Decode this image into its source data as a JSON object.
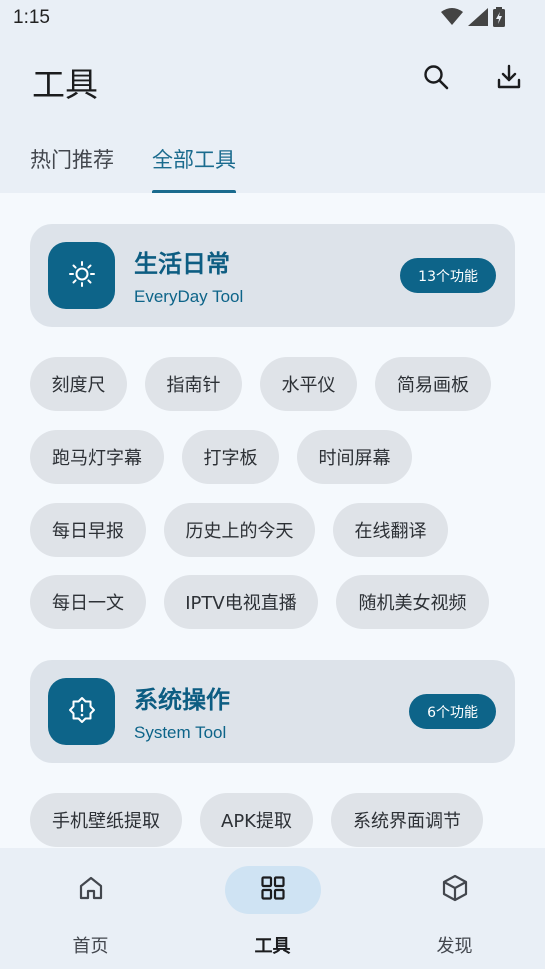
{
  "status_bar": {
    "time": "1:15"
  },
  "app_bar": {
    "title": "工具",
    "search_icon": "search-icon",
    "download_icon": "download-icon"
  },
  "tabs": [
    {
      "label": "热门推荐",
      "active": false
    },
    {
      "label": "全部工具",
      "active": true
    }
  ],
  "categories": [
    {
      "title": "生活日常",
      "subtitle": "EveryDay Tool",
      "badge": "13个功能",
      "icon": "sun-icon",
      "tools": [
        "刻度尺",
        "指南针",
        "水平仪",
        "简易画板",
        "跑马灯字幕",
        "打字板",
        "时间屏幕",
        "每日早报",
        "历史上的今天",
        "在线翻译",
        "每日一文",
        "IPTV电视直播",
        "随机美女视频"
      ]
    },
    {
      "title": "系统操作",
      "subtitle": "System Tool",
      "badge": "6个功能",
      "icon": "system-alert-icon",
      "tools": [
        "手机壁纸提取",
        "APK提取",
        "系统界面调节"
      ]
    }
  ],
  "bottom_nav": [
    {
      "label": "首页",
      "icon": "home-icon",
      "active": false
    },
    {
      "label": "工具",
      "icon": "grid-icon",
      "active": true
    },
    {
      "label": "发现",
      "icon": "cube-icon",
      "active": false
    }
  ],
  "colors": {
    "accent": "#0d6489",
    "header_bg": "#e9eff6",
    "page_bg": "#f5f9fd",
    "chip_bg": "#dfe3e8"
  }
}
